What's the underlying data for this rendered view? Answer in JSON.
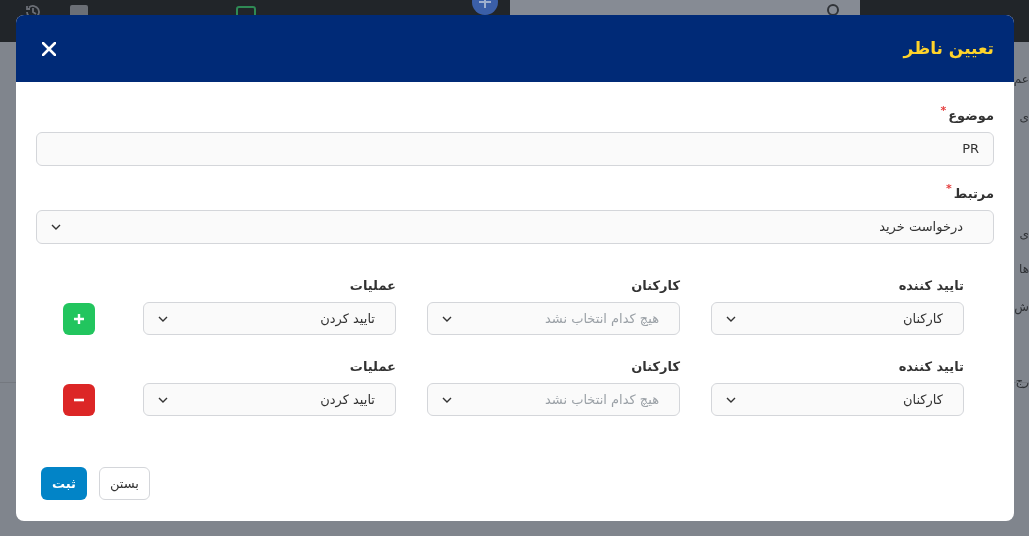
{
  "background": {
    "side_texts": [
      "عم",
      "ی",
      "ی",
      "ها",
      "ش",
      "رج"
    ]
  },
  "dialog": {
    "title": "تعیین ناظر",
    "fields": [
      {
        "label": "موضوع",
        "required_mark": "*",
        "kind": "text",
        "value": "PR"
      },
      {
        "label": "مرتبط",
        "required_mark": "*",
        "kind": "select",
        "value": "درخواست خرید"
      }
    ],
    "rows": [
      {
        "columns": [
          {
            "label": "تایید کننده",
            "value": "کارکنان"
          },
          {
            "label": "کارکنان",
            "placeholder": "هیچ کدام انتخاب نشد"
          },
          {
            "label": "عملیات",
            "value": "تایید کردن"
          }
        ],
        "kind": "add"
      },
      {
        "columns": [
          {
            "label": "تایید کننده",
            "value": "کارکنان"
          },
          {
            "label": "کارکنان",
            "placeholder": "هیچ کدام انتخاب نشد"
          },
          {
            "label": "عملیات",
            "value": "تایید کردن"
          }
        ],
        "kind": "remove"
      }
    ],
    "buttons": [
      {
        "label": "بستن",
        "kind": "secondary"
      },
      {
        "label": "ثبت",
        "kind": "primary"
      }
    ]
  }
}
